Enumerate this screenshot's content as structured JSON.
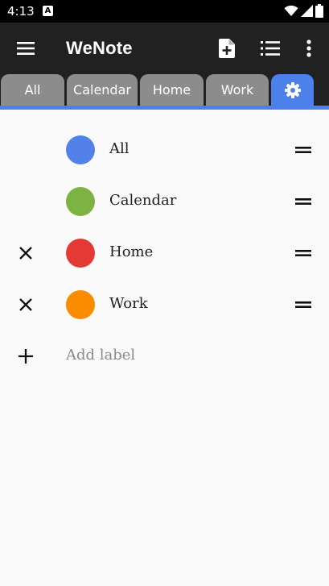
{
  "status_bar": {
    "time": "4:13",
    "notification_letter": "A",
    "icons": [
      "wifi-icon",
      "signal-icon",
      "battery-icon"
    ]
  },
  "app_bar": {
    "title": "WeNote",
    "icons": [
      "menu-icon",
      "new-note-icon",
      "list-view-icon",
      "more-vert-icon"
    ]
  },
  "tabs": [
    {
      "label": "All"
    },
    {
      "label": "Calendar"
    },
    {
      "label": "Home"
    },
    {
      "label": "Work"
    },
    {
      "label": "",
      "icon": "settings-gear-icon",
      "active": true
    }
  ],
  "labels": [
    {
      "name": "All",
      "color": "#5282e8",
      "deletable": false
    },
    {
      "name": "Calendar",
      "color": "#7cb342",
      "deletable": false
    },
    {
      "name": "Home",
      "color": "#e53935",
      "deletable": true
    },
    {
      "name": "Work",
      "color": "#fb8c00",
      "deletable": true
    }
  ],
  "add_label": {
    "placeholder": "Add label"
  },
  "colors": {
    "appbar": "#212121",
    "tab_inactive": "#8c8c8c",
    "accent": "#4c80ea",
    "background": "#fafafa"
  }
}
